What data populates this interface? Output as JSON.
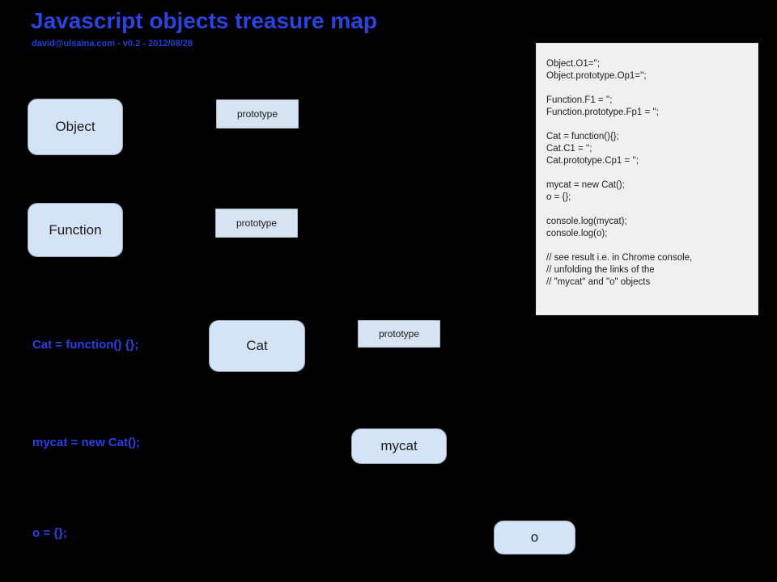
{
  "header": {
    "title": "Javascript objects treasure map",
    "subtitle": "david@ulsaina.com - v0.2 - 2012/08/28"
  },
  "colors": {
    "background": "#000000",
    "title": "#2b44e0",
    "caption": "#2b3fe8",
    "node_fill": "#d4e4f6",
    "node_border": "#9aa9bb",
    "panel_fill": "#f0f0f0"
  },
  "captions": [
    {
      "text": "Cat = function() {};"
    },
    {
      "text": "mycat = new Cat();"
    },
    {
      "text": "o = {};"
    }
  ],
  "nodes": [
    {
      "label": "Object",
      "shape": "rounded"
    },
    {
      "label": "prototype",
      "shape": "rect"
    },
    {
      "label": "Function",
      "shape": "rounded"
    },
    {
      "label": "prototype",
      "shape": "rect"
    },
    {
      "label": "Cat",
      "shape": "rounded"
    },
    {
      "label": "prototype",
      "shape": "rect"
    },
    {
      "label": "mycat",
      "shape": "rounded"
    },
    {
      "label": "o",
      "shape": "rounded"
    }
  ],
  "code_panel": {
    "lines": [
      "Object.O1='';",
      "Object.prototype.Op1='';",
      "",
      "Function.F1 = '';",
      "Function.prototype.Fp1 = '';",
      "",
      "Cat = function(){};",
      "Cat.C1 = '';",
      "Cat.prototype.Cp1 = '';",
      "",
      "mycat = new Cat();",
      "o = {};",
      "",
      "console.log(mycat);",
      "console.log(o);",
      "",
      "// see result i.e. in Chrome console,",
      "// unfolding the links of the",
      "// \"mycat\" and \"o\" objects"
    ]
  }
}
